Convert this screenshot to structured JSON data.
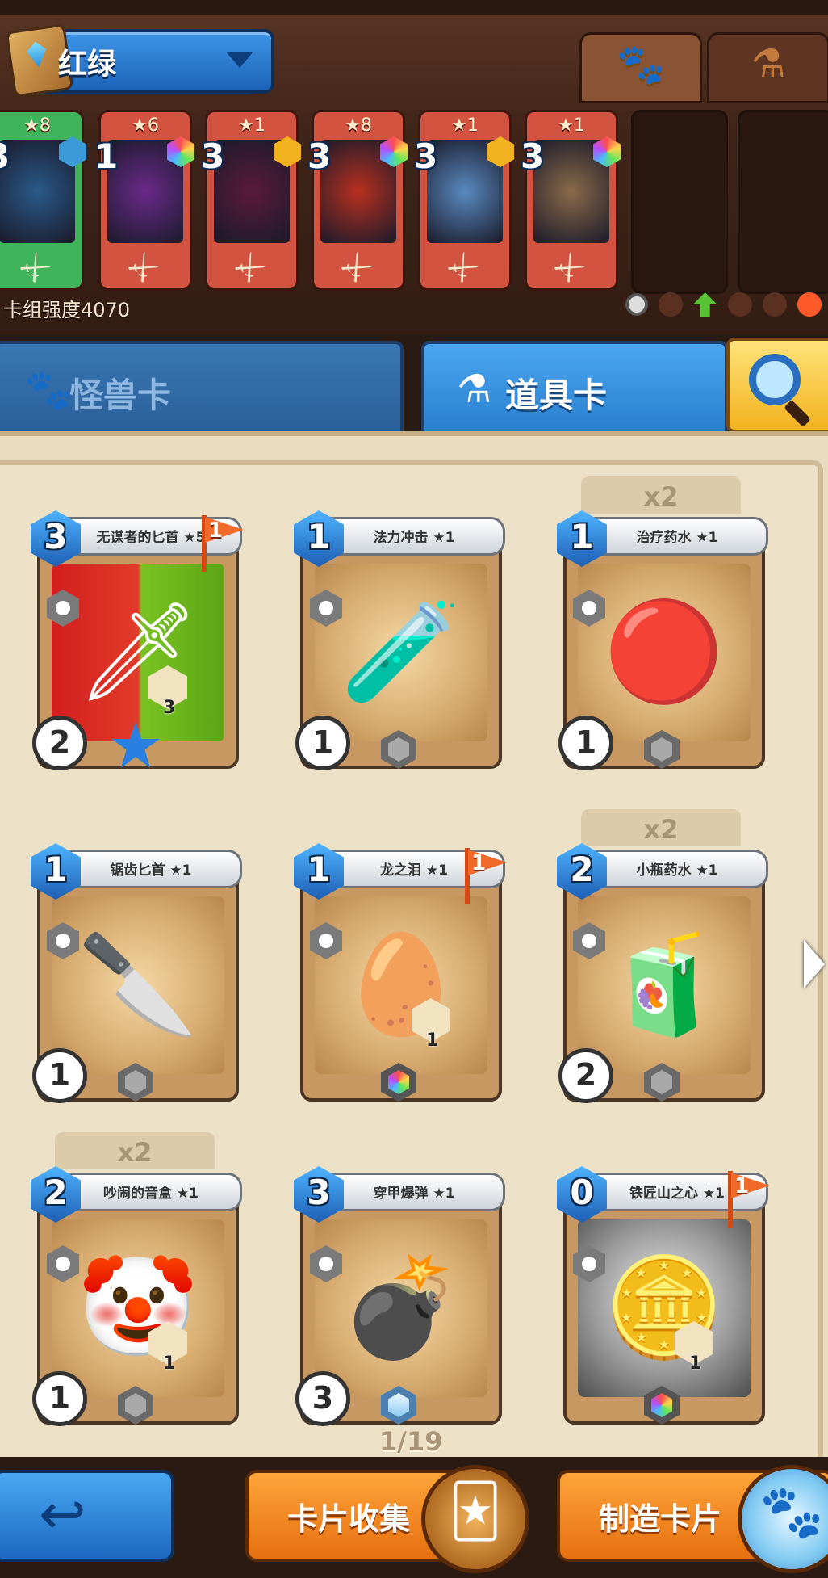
{
  "deck": {
    "name": "红绿",
    "strength_label": "卡组强度4070",
    "cards": [
      {
        "cost": "3",
        "stars": "★8",
        "color": "#3fb45a",
        "gem": "#3d9ad8",
        "art": "#2a5a8a"
      },
      {
        "cost": "1",
        "stars": "★6",
        "color": "#d2533f",
        "gem": "rainbow",
        "art": "#6a2a8a"
      },
      {
        "cost": "3",
        "stars": "★1",
        "color": "#d2533f",
        "gem": "#f2b21f",
        "art": "#5a1a3a"
      },
      {
        "cost": "3",
        "stars": "★8",
        "color": "#d2533f",
        "gem": "rainbow",
        "art": "#b83020"
      },
      {
        "cost": "3",
        "stars": "★1",
        "color": "#d2533f",
        "gem": "#f2b21f",
        "art": "#5a8ac0"
      },
      {
        "cost": "3",
        "stars": "★1",
        "color": "#d2533f",
        "gem": "rainbow",
        "art": "#8a6a4a"
      }
    ]
  },
  "filter_tabs": {
    "monster_icon": "paw-icon",
    "item_icon": "flask-icon"
  },
  "categories": {
    "monster_label": "怪兽卡",
    "item_label": "道具卡"
  },
  "cards": [
    {
      "name": "无谋者的匕首 ★5",
      "cost": "3",
      "flag": "1",
      "energy": "2",
      "dup": "",
      "rarity": "star",
      "art_style": "redgreen",
      "art_icon": "🗡",
      "ability_value": "3"
    },
    {
      "name": "法力冲击 ★1",
      "cost": "1",
      "flag": "",
      "energy": "1",
      "dup": "",
      "rarity": "plain",
      "art_style": "",
      "art_icon": "🧪"
    },
    {
      "name": "治疗药水 ★1",
      "cost": "1",
      "flag": "",
      "energy": "1",
      "dup": "x2",
      "rarity": "plain",
      "art_style": "",
      "art_icon": "🔴"
    },
    {
      "name": "锯齿匕首 ★1",
      "cost": "1",
      "flag": "",
      "energy": "1",
      "dup": "",
      "rarity": "plain",
      "art_style": "",
      "art_icon": "🔪"
    },
    {
      "name": "龙之泪 ★1",
      "cost": "1",
      "flag": "1",
      "energy": "",
      "dup": "",
      "rarity": "rainbow",
      "art_style": "",
      "art_icon": "🥚",
      "ability_value": "1"
    },
    {
      "name": "小瓶药水 ★1",
      "cost": "2",
      "flag": "",
      "energy": "2",
      "dup": "x2",
      "rarity": "plain",
      "art_style": "",
      "art_icon": "🧃"
    },
    {
      "name": "吵闹的音盒 ★1",
      "cost": "2",
      "flag": "",
      "energy": "1",
      "dup": "x2",
      "rarity": "plain",
      "art_style": "",
      "art_icon": "🤡",
      "ability_value": "1"
    },
    {
      "name": "穿甲爆弹 ★1",
      "cost": "3",
      "flag": "",
      "energy": "3",
      "dup": "",
      "rarity": "diamond",
      "art_style": "",
      "art_icon": "💣"
    },
    {
      "name": "铁匠山之心 ★1",
      "cost": "0",
      "flag": "1",
      "energy": "",
      "dup": "",
      "rarity": "rainbow",
      "art_style": "gray",
      "art_icon": "🪙",
      "ability_value": "1"
    }
  ],
  "page": "1/19",
  "buttons": {
    "collection_label": "卡片收集",
    "craft_label": "制造卡片"
  }
}
